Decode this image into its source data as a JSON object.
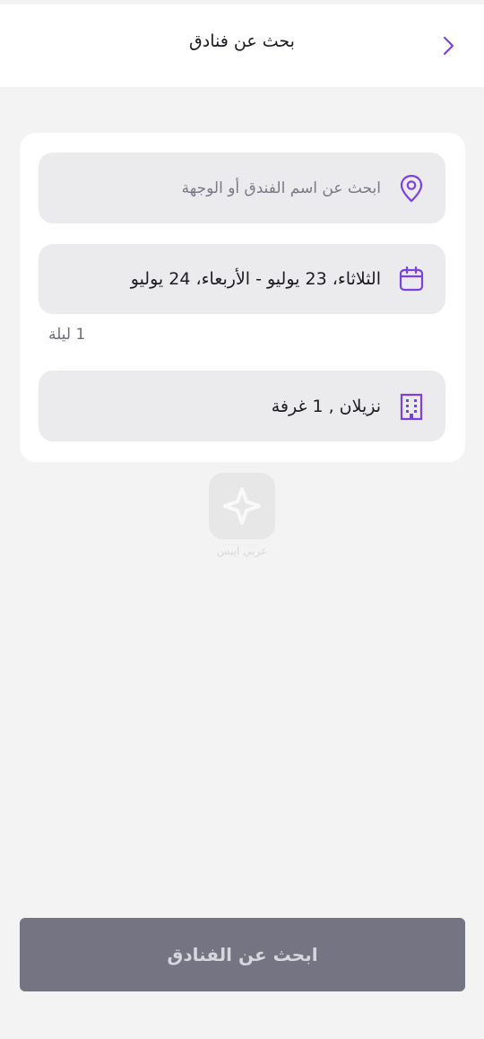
{
  "header": {
    "title": "بحث عن فنادق"
  },
  "search": {
    "placeholder": "ابحث عن اسم الفندق أو الوجهة",
    "icon": "location-pin-icon"
  },
  "dates": {
    "value": "الثلاثاء، 23 يوليو - الأربعاء، 24 يوليو",
    "icon": "calendar-icon",
    "nights": "1 ليلة"
  },
  "rooms": {
    "value": "نزيلان , 1 غرفة",
    "icon": "building-icon"
  },
  "watermark": {
    "text": "عربي ايبس"
  },
  "cta": {
    "label": "ابحث عن الفنادق"
  },
  "colors": {
    "accent": "#7b3fe4",
    "cta_disabled": "#747482",
    "field_bg": "#ebebed",
    "page_bg": "#f3f3f3"
  }
}
